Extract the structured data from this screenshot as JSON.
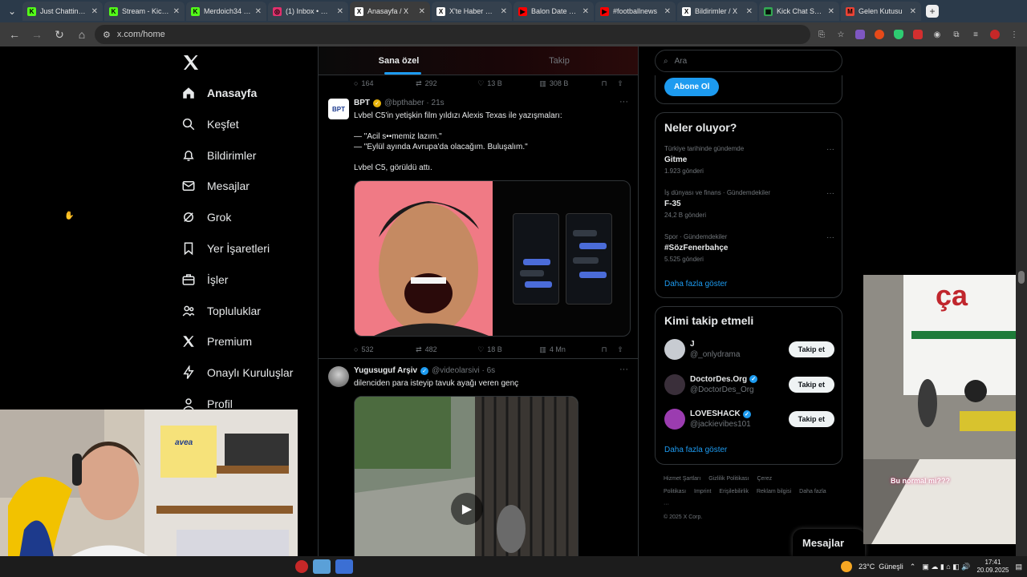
{
  "browser": {
    "tabs": [
      {
        "title": "Just Chatting - Kick",
        "favicon_color": "#53fc18",
        "favicon_text": "K"
      },
      {
        "title": "Stream - Kick Dash",
        "favicon_color": "#53fc18",
        "favicon_text": "K"
      },
      {
        "title": "Merdoich34 - Kick",
        "favicon_color": "#53fc18",
        "favicon_text": "K"
      },
      {
        "title": "(1) Inbox • Chats",
        "favicon_color": "#e1306c",
        "favicon_text": "◎"
      },
      {
        "title": "Anasayfa / X",
        "favicon_color": "#ffffff",
        "favicon_text": "X",
        "active": true
      },
      {
        "title": "X'te Haber Rep",
        "favicon_color": "#ffffff",
        "favicon_text": "X"
      },
      {
        "title": "Balon Date Sho",
        "favicon_color": "#ff0000",
        "favicon_text": "▶"
      },
      {
        "title": "#footballnews",
        "favicon_color": "#ff0000",
        "favicon_text": "▶"
      },
      {
        "title": "Bildirimler / X",
        "favicon_color": "#ffffff",
        "favicon_text": "X"
      },
      {
        "title": "Kick Chat Sear",
        "favicon_color": "#34a853",
        "favicon_text": "▦"
      },
      {
        "title": "Gelen Kutusu",
        "favicon_color": "#ea4335",
        "favicon_text": "M"
      }
    ],
    "url": "x.com/home"
  },
  "sidebar": {
    "items": [
      {
        "label": "Anasayfa",
        "icon": "home-icon",
        "active": true
      },
      {
        "label": "Keşfet",
        "icon": "search-icon"
      },
      {
        "label": "Bildirimler",
        "icon": "bell-icon"
      },
      {
        "label": "Mesajlar",
        "icon": "mail-icon"
      },
      {
        "label": "Grok",
        "icon": "grok-icon"
      },
      {
        "label": "Yer İşaretleri",
        "icon": "bookmark-icon"
      },
      {
        "label": "İşler",
        "icon": "briefcase-icon"
      },
      {
        "label": "Topluluklar",
        "icon": "people-icon"
      },
      {
        "label": "Premium",
        "icon": "x-logo-icon"
      },
      {
        "label": "Onaylı Kuruluşlar",
        "icon": "lightning-icon"
      },
      {
        "label": "Profil",
        "icon": "person-icon"
      }
    ]
  },
  "feed": {
    "tabs": [
      "Sana özel",
      "Takip"
    ],
    "prev_actions": {
      "replies": "164",
      "reposts": "292",
      "likes": "13 B",
      "views": "308 B"
    },
    "tweets": [
      {
        "name": "BPT",
        "handle": "@bpthaber · 21s",
        "avatar_text": "BPT",
        "verified_color": "#e8b30b",
        "text": "Lvbel C5'in yetişkin film yıldızı Alexis Texas ile yazışmaları:\n\n— \"Acil s••memiz lazım.\"\n— \"Eylül ayında Avrupa'da olacağım. Buluşalım.\"\n\nLvbel C5, görüldü attı.",
        "actions": {
          "replies": "532",
          "reposts": "482",
          "likes": "18 B",
          "views": "4 Mn"
        }
      },
      {
        "name": "Yugusuguf Arşiv",
        "handle": "@videolarsivi · 6s",
        "verified_color": "#1d9bf0",
        "text": "dilenciden para isteyip tavuk ayağı veren genç"
      }
    ]
  },
  "right": {
    "search_placeholder": "Ara",
    "subscribe_label": "Abone Ol",
    "trends_title": "Neler oluyor?",
    "trends": [
      {
        "context": "Türkiye tarihinde gündemde",
        "topic": "Gitme",
        "posts": "1.923 gönderi"
      },
      {
        "context": "İş dünyası ve finans · Gündemdekiler",
        "topic": "F-35",
        "posts": "24,2 B gönderi"
      },
      {
        "context": "Spor · Gündemdekiler",
        "topic": "#SözFenerbahçe",
        "posts": "5.525 gönderi"
      }
    ],
    "trends_more": "Daha fazla göster",
    "follow_title": "Kimi takip etmeli",
    "follow": [
      {
        "name": "J",
        "handle": "@_onlydrama",
        "verified": false,
        "avatar_color": "#c7cbd1"
      },
      {
        "name": "DoctorDes.Org",
        "handle": "@DoctorDes_Org",
        "verified": true,
        "avatar_color": "#3a2f3a"
      },
      {
        "name": "LOVESHACK",
        "handle": "@jackievibes101",
        "verified": true,
        "avatar_color": "#9b3cb0"
      }
    ],
    "follow_button": "Takip et",
    "follow_more": "Daha fazla göster",
    "footer_links": [
      "Hizmet Şartları",
      "Gizlilik Politikası",
      "Çerez Politikası",
      "Imprint",
      "Erişilebilirlik",
      "Reklam bilgisi",
      "Daha fazla ···"
    ],
    "copyright": "© 2025 X Corp."
  },
  "messages_label": "Mesajlar",
  "overlay_caption": "Bu normal mi???",
  "taskbar": {
    "weather": "23°C  Güneşli",
    "time": "17:41",
    "date": "20.09.2025"
  },
  "webcam_logo": "avea"
}
